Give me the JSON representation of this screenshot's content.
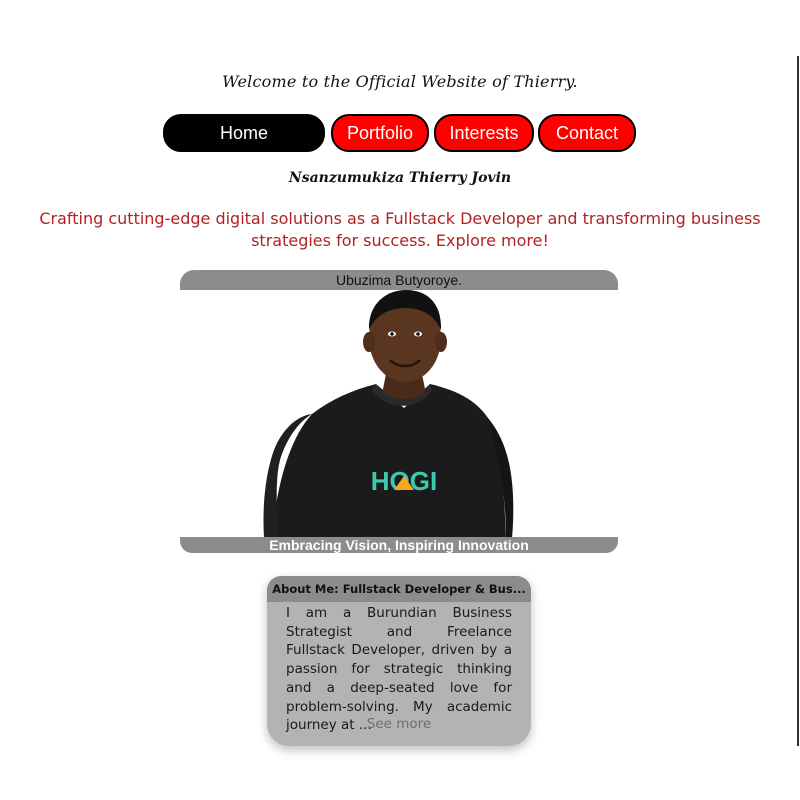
{
  "header": {
    "welcome_text": "Welcome to the Official Website of Thierry."
  },
  "nav": {
    "items": [
      {
        "label": "Home",
        "active": true
      },
      {
        "label": "Portfolio",
        "active": false
      },
      {
        "label": "Interests",
        "active": false
      },
      {
        "label": "Contact",
        "active": false
      }
    ]
  },
  "profile": {
    "name": "Nsanzumukiza Thierry Jovin",
    "tagline": "Crafting cutting-edge digital solutions as a Fullstack Developer and transforming business strategies for success. Explore more!",
    "card_header": "Ubuzima Butyoroye.",
    "card_footer": "Embracing Vision, Inspiring Innovation",
    "shirt_logo_text": "HOGI"
  },
  "about": {
    "title": "About Me: Fullstack Developer & Bus...",
    "body": "I am a Burundian Business Strategist and Freelance Fullstack Developer, driven by a passion for strategic thinking and a deep-seated love for problem-solving. My academic journey at ...",
    "see_more_label": "See more"
  },
  "colors": {
    "accent_red": "#ff0000",
    "tagline_red": "#b22222",
    "card_gray": "#8c8c8c",
    "about_bg": "#b3b3b3",
    "shirt_logo_teal": "#3cc9b0"
  },
  "icons": {
    "profile_photo": "person-photo"
  }
}
